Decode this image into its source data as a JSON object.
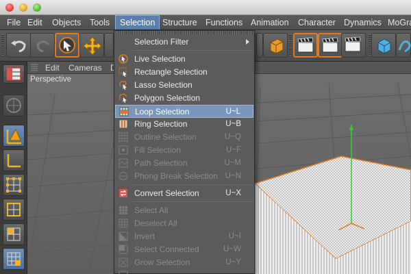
{
  "menubar": {
    "items": [
      {
        "label": "File"
      },
      {
        "label": "Edit"
      },
      {
        "label": "Objects"
      },
      {
        "label": "Tools"
      },
      {
        "label": "Selection"
      },
      {
        "label": "Structure"
      },
      {
        "label": "Functions"
      },
      {
        "label": "Animation"
      },
      {
        "label": "Character"
      },
      {
        "label": "Dynamics"
      },
      {
        "label": "MoGra"
      }
    ],
    "active": "Selection"
  },
  "viewport_header": {
    "edit": "Edit",
    "cameras": "Cameras",
    "display": "D"
  },
  "viewport": {
    "title": "Perspective"
  },
  "dropdown": {
    "items": [
      {
        "label": "Selection Filter",
        "shortcut": "",
        "submenu": true,
        "disabled": false,
        "hover": false
      },
      {
        "label": "Live Selection",
        "shortcut": "",
        "disabled": false,
        "hover": false
      },
      {
        "label": "Rectangle Selection",
        "shortcut": "",
        "disabled": false,
        "hover": false
      },
      {
        "label": "Lasso Selection",
        "shortcut": "",
        "disabled": false,
        "hover": false
      },
      {
        "label": "Polygon Selection",
        "shortcut": "",
        "disabled": false,
        "hover": false
      },
      {
        "label": "Loop Selection",
        "shortcut": "U~L",
        "disabled": false,
        "hover": true
      },
      {
        "label": "Ring Selection",
        "shortcut": "U~B",
        "disabled": false,
        "hover": false
      },
      {
        "label": "Outline Selection",
        "shortcut": "U~Q",
        "disabled": true,
        "hover": false
      },
      {
        "label": "Fill Selection",
        "shortcut": "U~F",
        "disabled": true,
        "hover": false
      },
      {
        "label": "Path Selection",
        "shortcut": "U~M",
        "disabled": true,
        "hover": false
      },
      {
        "label": "Phong Break Selection",
        "shortcut": "U~N",
        "disabled": true,
        "hover": false
      },
      {
        "label": "Convert Selection",
        "shortcut": "U~X",
        "disabled": false,
        "hover": false
      },
      {
        "label": "Select All",
        "shortcut": "",
        "disabled": true,
        "hover": false
      },
      {
        "label": "Deselect All",
        "shortcut": "",
        "disabled": true,
        "hover": false
      },
      {
        "label": "Invert",
        "shortcut": "U~I",
        "disabled": true,
        "hover": false
      },
      {
        "label": "Select Connected",
        "shortcut": "U~W",
        "disabled": true,
        "hover": false
      },
      {
        "label": "Grow Selection",
        "shortcut": "U~Y",
        "disabled": true,
        "hover": false
      }
    ]
  },
  "colors": {
    "accent_orange": "#e07a1f",
    "menu_highlight": "#7a97bb",
    "axis_green": "#2fd12f"
  }
}
